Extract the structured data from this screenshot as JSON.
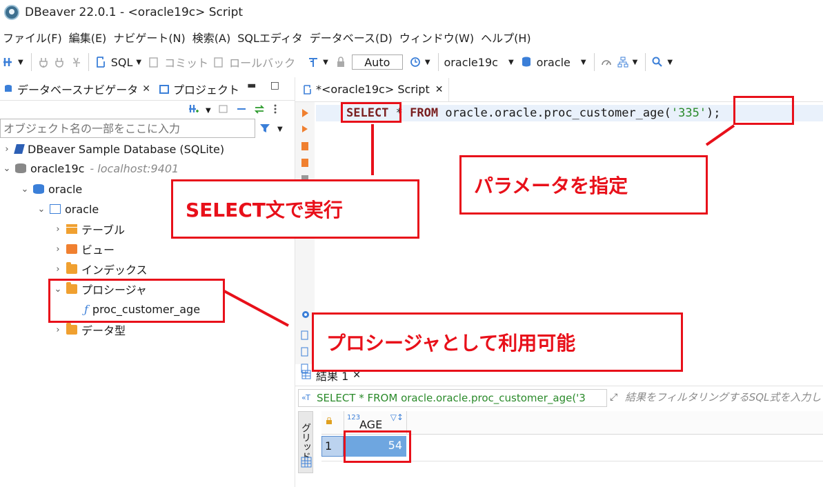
{
  "window": {
    "title": "DBeaver 22.0.1 - <oracle19c> Script"
  },
  "menu": [
    "ファイル(F)",
    "編集(E)",
    "ナビゲート(N)",
    "検索(A)",
    "SQLエディタ",
    "データベース(D)",
    "ウィンドウ(W)",
    "ヘルプ(H)"
  ],
  "toolbar": {
    "sql": "SQL",
    "commit": "コミット",
    "rollback": "ロールバック",
    "mode": "Auto",
    "connection": "oracle19c",
    "schema": "oracle"
  },
  "navigator": {
    "tab_db": "データベースナビゲータ",
    "tab_project": "プロジェクト",
    "filter_placeholder": "オブジェクト名の一部をここに入力",
    "tree": {
      "sample_db": "DBeaver Sample Database (SQLite)",
      "conn": "oracle19c",
      "conn_host": "- localhost:9401",
      "db": "oracle",
      "schema": "oracle",
      "tables": "テーブル",
      "views": "ビュー",
      "indexes": "インデックス",
      "procedures": "プロシージャ",
      "procedure_item": "proc_customer_age",
      "datatypes": "データ型"
    }
  },
  "editor": {
    "tab": "*<oracle19c> Script",
    "code": {
      "kw_select": "SELECT",
      "star": " * ",
      "kw_from": "FROM",
      "target": " oracle.oracle.proc_customer_age(",
      "arg": "'335'",
      "end": ");"
    }
  },
  "results": {
    "tab": "結果 1",
    "query": "SELECT * FROM oracle.oracle.proc_customer_age('3",
    "filter_placeholder": "結果をフィルタリングするSQL式を入力し",
    "grid_tab": "グリッド",
    "column_type": "123",
    "column": "AGE",
    "row_num": "1",
    "value": "54"
  },
  "annotations": {
    "select": "SELECT文で実行",
    "param": "パラメータを指定",
    "proc": "プロシージャとして利用可能"
  },
  "colors": {
    "annotation": "#e8101a",
    "keyword": "#7a1f1f",
    "string": "#2a8a2a",
    "selected_cell": "#6ea6e0"
  }
}
